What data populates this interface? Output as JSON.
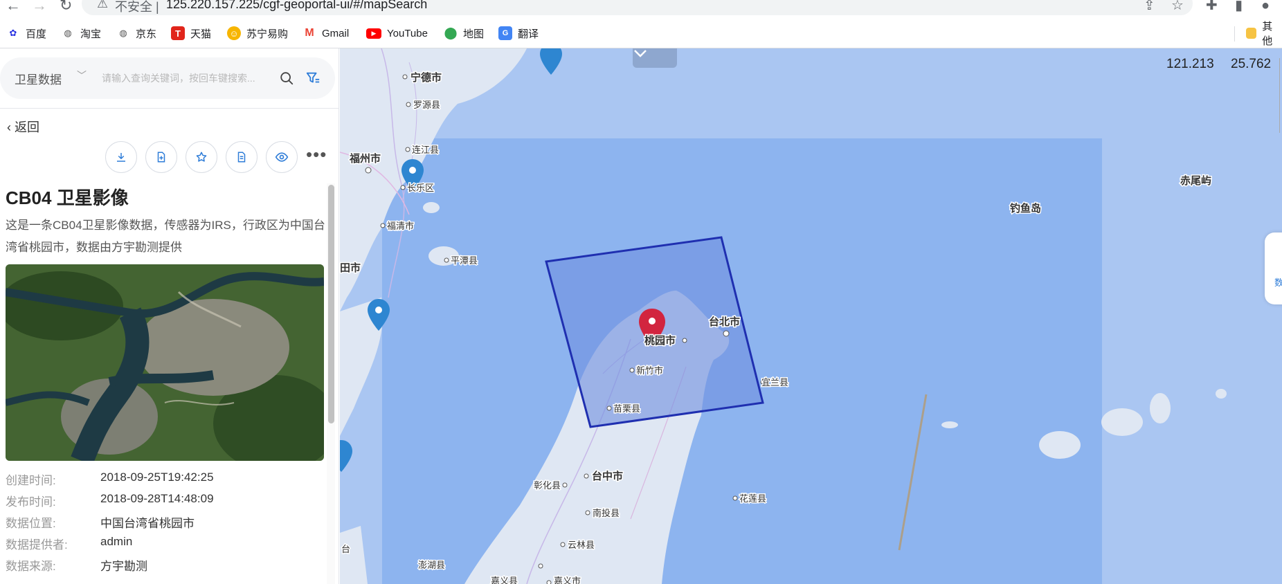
{
  "browser": {
    "insecure_label": "不安全 |",
    "url": "125.220.157.225/cgf-geoportal-ui/#/mapSearch",
    "bookmarks": [
      {
        "label": "百度",
        "icon": "baidu-icon",
        "color": "#2932e1"
      },
      {
        "label": "淘宝",
        "icon": "globe-icon",
        "color": "#555555"
      },
      {
        "label": "京东",
        "icon": "globe-icon",
        "color": "#555555"
      },
      {
        "label": "天猫",
        "icon": "tmall-icon",
        "color": "#e1251b"
      },
      {
        "label": "苏宁易购",
        "icon": "suning-icon",
        "color": "#f7b500"
      },
      {
        "label": "Gmail",
        "icon": "gmail-icon",
        "color": "#ea4335"
      },
      {
        "label": "YouTube",
        "icon": "youtube-icon",
        "color": "#ff0000"
      },
      {
        "label": "地图",
        "icon": "maps-pin-icon",
        "color": "#34a853"
      },
      {
        "label": "翻译",
        "icon": "translate-icon",
        "color": "#4285f4"
      }
    ],
    "other_bookmarks": "其他"
  },
  "panel": {
    "search": {
      "category": "卫星数据",
      "placeholder": "请输入查询关键词，按回车键搜索..."
    },
    "back_label": "返回",
    "title": "CB04 卫星影像",
    "description": "这是一条CB04卫星影像数据，传感器为IRS，行政区为中国台湾省桃园市，数据由方宇勘测提供",
    "meta": [
      {
        "key": "创建时间:",
        "value": "2018-09-25T19:42:25"
      },
      {
        "key": "发布时间:",
        "value": "2018-09-28T14:48:09"
      },
      {
        "key": "数据位置:",
        "value": "中国台湾省桃园市"
      },
      {
        "key": "数据提供者:",
        "value": "admin"
      },
      {
        "key": "数据来源:",
        "value": "方宇勘测"
      }
    ]
  },
  "map": {
    "coord_lon": "121.213",
    "coord_lat": "25.762",
    "side_label": "数",
    "labels": {
      "ningde": "宁德市",
      "luoyuan": "罗源县",
      "lianjiang": "连江县",
      "fuzhou": "福州市",
      "changle": "长乐区",
      "fuqing": "福清市",
      "pingtan": "平潭县",
      "putian": "田市",
      "taoyuan": "桃园市",
      "taibei": "台北市",
      "xinzhu": "新竹市",
      "yilan": "宜兰县",
      "miaoli": "苗栗县",
      "taizhong": "台中市",
      "zhanghua": "彰化县",
      "nantou": "南投县",
      "hualian": "花莲县",
      "yunlin": "云林县",
      "penghu": "澎湖县",
      "jiayi": "嘉义市",
      "jiayi_county": "嘉义县",
      "diaoyu": "钓鱼岛",
      "chiwei": "赤尾屿",
      "tai": "台"
    }
  }
}
